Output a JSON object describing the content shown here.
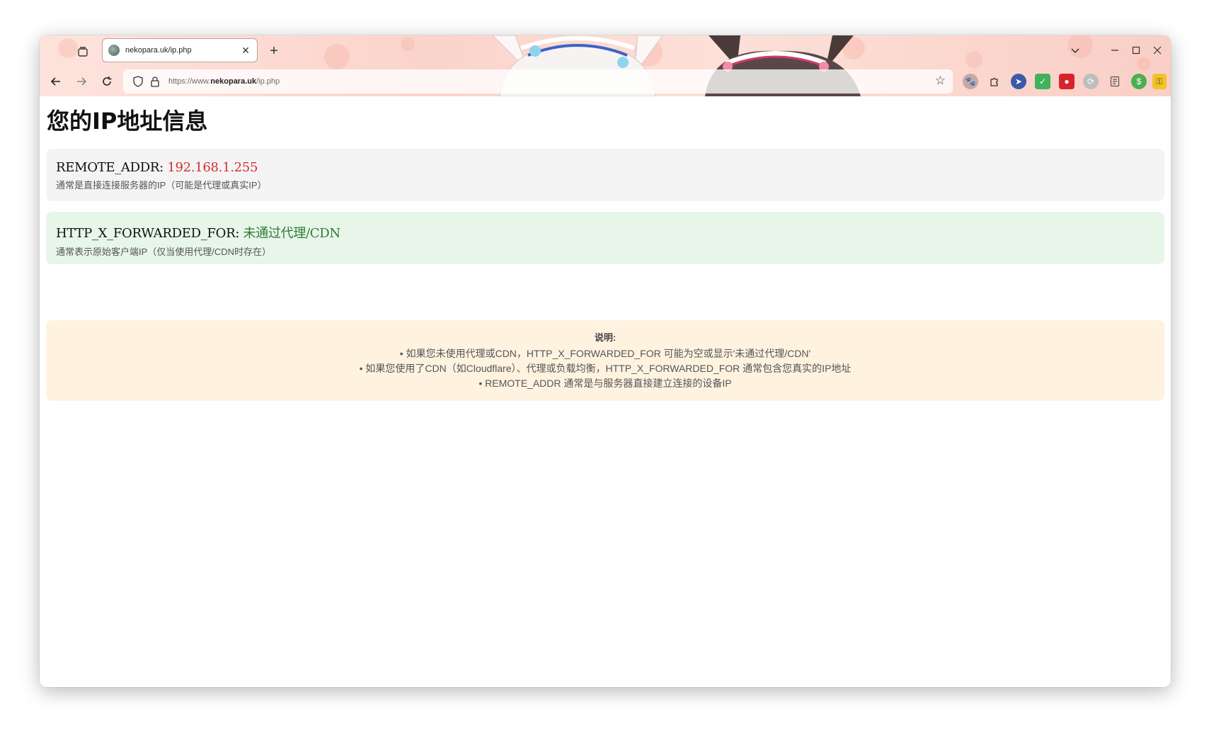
{
  "browser": {
    "tab": {
      "title": "nekopara.uk/ip.php"
    },
    "url": {
      "scheme": "https://www.",
      "host": "nekopara.uk",
      "path": "/ip.php"
    },
    "window_controls": {
      "minimize": "—",
      "maximize": "☐",
      "close": "✕"
    }
  },
  "page": {
    "title": "您的IP地址信息",
    "remote": {
      "label": "REMOTE_ADDR:",
      "value": "192.168.1.255",
      "desc": "通常是直接连接服务器的IP（可能是代理或真实IP）"
    },
    "forwarded": {
      "label": "HTTP_X_FORWARDED_FOR:",
      "value": "未通过代理/CDN",
      "desc": "通常表示原始客户端IP（仅当使用代理/CDN时存在）"
    },
    "note": {
      "title": "说明:",
      "items": [
        "• 如果您未使用代理或CDN，HTTP_X_FORWARDED_FOR 可能为空或显示'未通过代理/CDN'",
        "• 如果您使用了CDN（如Cloudflare）、代理或负载均衡，HTTP_X_FORWARDED_FOR 通常包含您真实的IP地址",
        "• REMOTE_ADDR 通常是与服务器直接建立连接的设备IP"
      ]
    }
  },
  "colors": {
    "remote_value": "#d32f2f",
    "forwarded_value": "#2e7d32",
    "remote_bg": "#f4f4f4",
    "forwarded_bg": "#e8f5e9",
    "note_bg": "#fff3e0"
  },
  "icons": {
    "tab_overview": "tab-overview-icon",
    "back": "arrow-left-icon",
    "forward": "arrow-right-icon",
    "reload": "reload-icon",
    "shield": "shield-icon",
    "lock": "lock-icon",
    "bookmark": "star-icon",
    "extensions": [
      "cat-mascot-icon",
      "puzzle-icon",
      "cursor-icon",
      "shield-check-icon",
      "ublock-icon",
      "translate-icon",
      "reader-icon",
      "dollar-icon",
      "key-icon",
      "menu-icon"
    ]
  }
}
